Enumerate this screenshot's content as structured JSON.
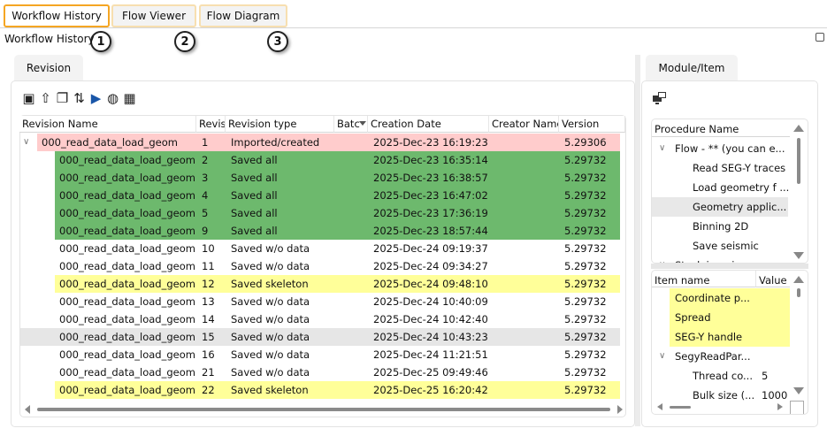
{
  "tabs": [
    {
      "label": "Workflow History",
      "active": true
    },
    {
      "label": "Flow Viewer"
    },
    {
      "label": "Flow Diagram"
    }
  ],
  "callouts": [
    "1",
    "2",
    "3"
  ],
  "section_title": "Workflow History",
  "left_tab": "Revision",
  "toolbar_icons": [
    "open-revision-icon",
    "export-icon",
    "copy-icon",
    "compare-icon",
    "play-icon",
    "globe-icon",
    "grid-icon"
  ],
  "columns": [
    "Revision Name",
    "Revis",
    "Revision type",
    "Batc",
    "Creation Date",
    "Creator Name",
    "Version"
  ],
  "colors": {
    "imported": "#ffcccc",
    "saved_all": "#6db96d",
    "skeleton": "#ffff99",
    "selected": "#e6e6e6",
    "highlight_tab": "#f5a623"
  },
  "rows": [
    {
      "name": "000_read_data_load_geom",
      "rev": "1",
      "type": "Imported/created",
      "date": "2025-Dec-23 16:19:23",
      "version": "5.29306",
      "style": "imported",
      "parent": true
    },
    {
      "name": "000_read_data_load_geom",
      "rev": "2",
      "type": "Saved all",
      "date": "2025-Dec-23 16:35:14",
      "version": "5.29732",
      "style": "saved_all"
    },
    {
      "name": "000_read_data_load_geom",
      "rev": "3",
      "type": "Saved all",
      "date": "2025-Dec-23 16:38:57",
      "version": "5.29732",
      "style": "saved_all"
    },
    {
      "name": "000_read_data_load_geom",
      "rev": "4",
      "type": "Saved all",
      "date": "2025-Dec-23 16:47:02",
      "version": "5.29732",
      "style": "saved_all"
    },
    {
      "name": "000_read_data_load_geom",
      "rev": "5",
      "type": "Saved all",
      "date": "2025-Dec-23 17:36:19",
      "version": "5.29732",
      "style": "saved_all"
    },
    {
      "name": "000_read_data_load_geom",
      "rev": "9",
      "type": "Saved all",
      "date": "2025-Dec-23 18:57:44",
      "version": "5.29732",
      "style": "saved_all"
    },
    {
      "name": "000_read_data_load_geom",
      "rev": "10",
      "type": "Saved w/o data",
      "date": "2025-Dec-24 09:19:37",
      "version": "5.29732",
      "style": ""
    },
    {
      "name": "000_read_data_load_geom",
      "rev": "11",
      "type": "Saved w/o data",
      "date": "2025-Dec-24 09:34:27",
      "version": "5.29732",
      "style": ""
    },
    {
      "name": "000_read_data_load_geom",
      "rev": "12",
      "type": "Saved skeleton",
      "date": "2025-Dec-24 09:48:10",
      "version": "5.29732",
      "style": "skeleton"
    },
    {
      "name": "000_read_data_load_geom",
      "rev": "13",
      "type": "Saved w/o data",
      "date": "2025-Dec-24 10:40:09",
      "version": "5.29732",
      "style": ""
    },
    {
      "name": "000_read_data_load_geom",
      "rev": "14",
      "type": "Saved w/o data",
      "date": "2025-Dec-24 10:42:40",
      "version": "5.29732",
      "style": ""
    },
    {
      "name": "000_read_data_load_geom",
      "rev": "15",
      "type": "Saved w/o data",
      "date": "2025-Dec-24 10:43:23",
      "version": "5.29732",
      "style": "selected"
    },
    {
      "name": "000_read_data_load_geom",
      "rev": "16",
      "type": "Saved w/o data",
      "date": "2025-Dec-24 11:21:51",
      "version": "5.29732",
      "style": ""
    },
    {
      "name": "000_read_data_load_geom",
      "rev": "21",
      "type": "Saved w/o data",
      "date": "2025-Dec-25 09:49:46",
      "version": "5.29732",
      "style": ""
    },
    {
      "name": "000_read_data_load_geom",
      "rev": "22",
      "type": "Saved skeleton",
      "date": "2025-Dec-25 16:20:42",
      "version": "5.29732",
      "style": "skeleton"
    }
  ],
  "right_tab": "Module/Item",
  "procedure": {
    "header": "Procedure Name",
    "items": [
      {
        "label": "Flow - **  (you can e...",
        "level": 0,
        "expanded": true
      },
      {
        "label": "Read SEG-Y traces",
        "level": 1
      },
      {
        "label": "Load geometry f ...",
        "level": 1
      },
      {
        "label": "Geometry applic...",
        "level": 1,
        "selected": true
      },
      {
        "label": "Binning 2D",
        "level": 1
      },
      {
        "label": "Save seismic",
        "level": 1
      },
      {
        "label": "Stack imaging",
        "level": 0,
        "expanded": true
      }
    ]
  },
  "items": {
    "headers": [
      "Item name",
      "Value"
    ],
    "rows": [
      {
        "name": "Coordinate p...",
        "value": "",
        "highlight": true,
        "level": 0
      },
      {
        "name": "Spread",
        "value": "",
        "highlight": true,
        "level": 0
      },
      {
        "name": "SEG-Y handle",
        "value": "",
        "highlight": true,
        "level": 0
      },
      {
        "name": "SegyReadPar...",
        "value": "",
        "level": 0,
        "expanded": true
      },
      {
        "name": "Thread co...",
        "value": "5",
        "level": 1
      },
      {
        "name": "Bulk size (...",
        "value": "1000",
        "level": 1
      }
    ]
  }
}
